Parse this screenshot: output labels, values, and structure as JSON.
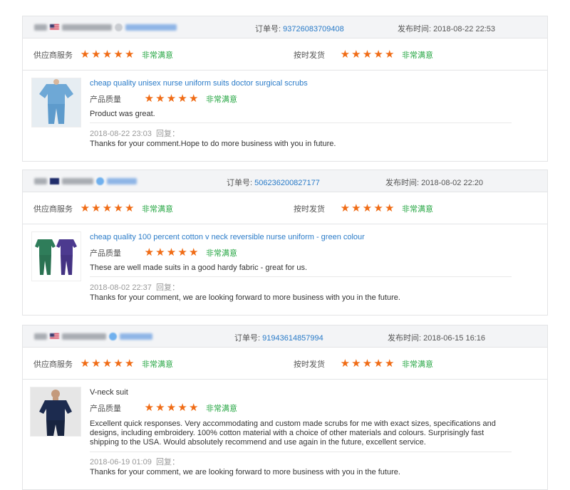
{
  "labels": {
    "order": "订单号:",
    "published": "发布时间:",
    "supplier_service": "供应商服务",
    "on_time_delivery": "按时发货",
    "product_quality": "产品质量",
    "very_satisfied": "非常满意",
    "reply": "回复："
  },
  "star_icon": "★",
  "colors": {
    "star": "#f06c16",
    "satisfied": "#28a745",
    "link": "#2a7bc8",
    "header_bg": "#f3f4f6"
  },
  "reviews": [
    {
      "order_no": "93726083709408",
      "published": "2018-08-22 22:53",
      "supplier_rating": 5,
      "delivery_rating": 5,
      "product": "cheap quality unisex nurse uniform suits doctor surgical scrubs",
      "product_rating": 5,
      "comment": "Product was great.",
      "reply_date": "2018-08-22 23:03",
      "reply_text": "Thanks for your comment.Hope to do more business with you in future.",
      "thumb": "light-blue-scrubs"
    },
    {
      "order_no": "506236200827177",
      "published": "2018-08-02 22:20",
      "supplier_rating": 5,
      "delivery_rating": 5,
      "product": "cheap quality 100 percent cotton v neck reversible nurse uniform - green colour",
      "product_rating": 5,
      "comment": "These are well made suits in a good hardy fabric - great for us.",
      "reply_date": "2018-08-02 22:37",
      "reply_text": "Thanks for your comment, we are looking forward to more business with you in the future.",
      "thumb": "green-and-purple-scrubs"
    },
    {
      "order_no": "91943614857994",
      "published": "2018-06-15 16:16",
      "supplier_rating": 5,
      "delivery_rating": 5,
      "product": "V-neck suit",
      "product_rating": 5,
      "comment": "Excellent quick responses. Very accommodating and custom made scrubs for me with exact sizes, specifications and designs, including embroidery. 100% cotton material with a choice of other materials and colours. Surprisingly fast shipping to the USA. Would absolutely recommend and use again in the future, excellent service.",
      "reply_date": "2018-06-19 01:09",
      "reply_text": "Thanks for your comment, we are looking forward to more business with you in the future.",
      "thumb": "navy-scrubs-model"
    }
  ]
}
